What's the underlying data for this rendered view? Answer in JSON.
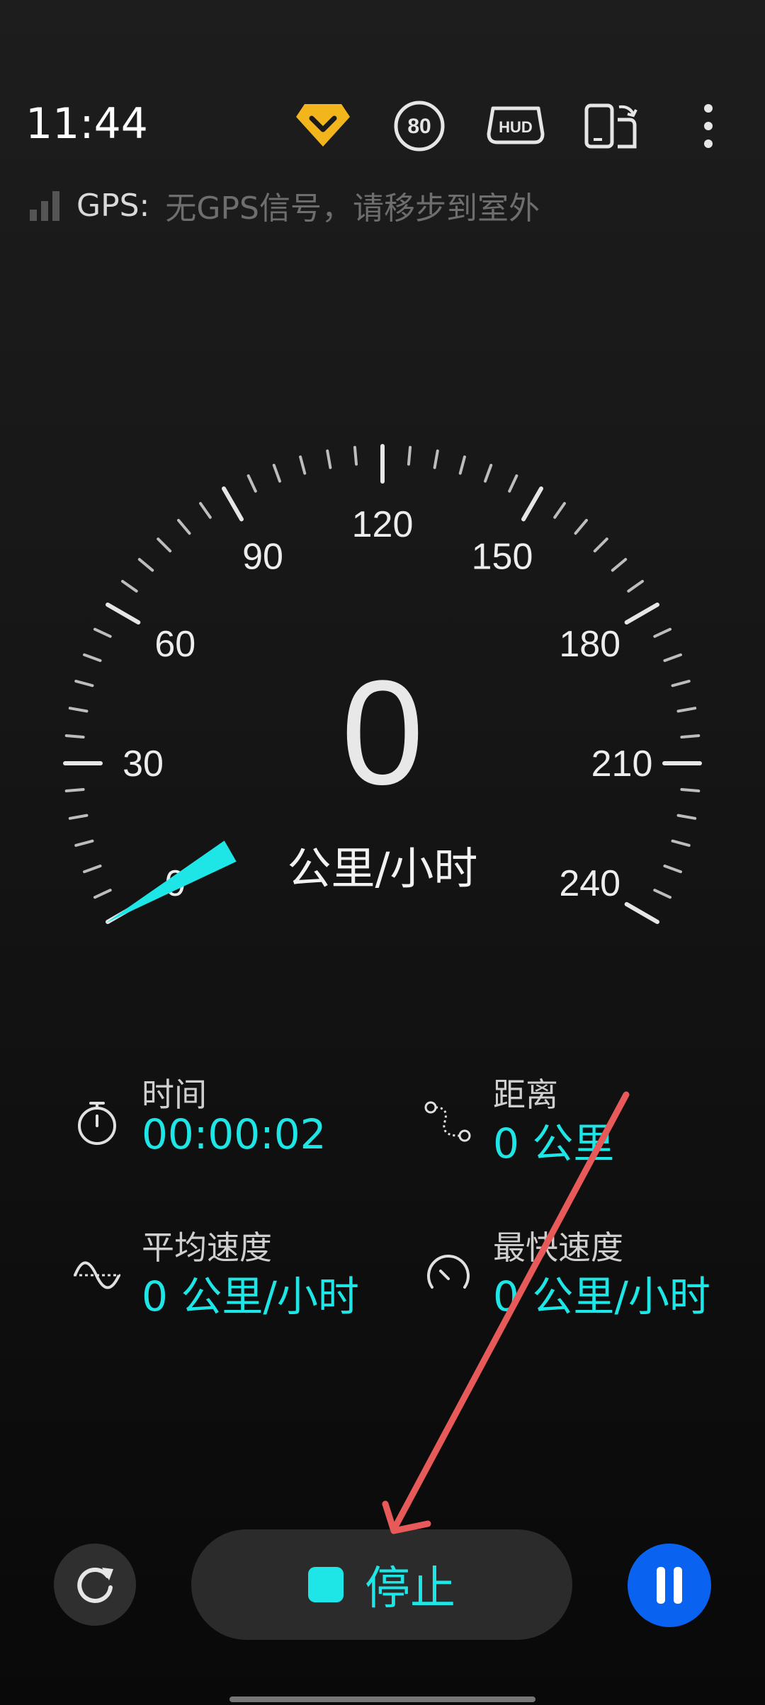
{
  "status": {
    "time": "11:44"
  },
  "toolbar": {
    "speed_limit": "80",
    "hud_label": "HUD",
    "icons": [
      "premium-badge-icon",
      "speed-limit-icon",
      "hud-icon",
      "screen-rotate-icon",
      "more-vert-icon"
    ]
  },
  "gps": {
    "label": "GPS:",
    "message": "无GPS信号，请移步到室外"
  },
  "speedometer": {
    "speed": "0",
    "unit": "公里/小时",
    "scale_labels": [
      "0",
      "30",
      "60",
      "90",
      "120",
      "150",
      "180",
      "210",
      "240"
    ],
    "max_speed": 240,
    "needle_value": 0
  },
  "stats": {
    "time": {
      "label": "时间",
      "value": "00:00:02"
    },
    "distance": {
      "label": "距离",
      "value": "0 公里"
    },
    "avg_speed": {
      "label": "平均速度",
      "value": "0 公里/小时"
    },
    "max_speed": {
      "label": "最快速度",
      "value": "0 公里/小时"
    }
  },
  "controls": {
    "stop_label": "停止"
  },
  "colors": {
    "accent": "#1fe6e6",
    "needle": "#1fe6e6",
    "pause_button": "#0a62f0",
    "annotation_arrow": "#e85a5a"
  }
}
